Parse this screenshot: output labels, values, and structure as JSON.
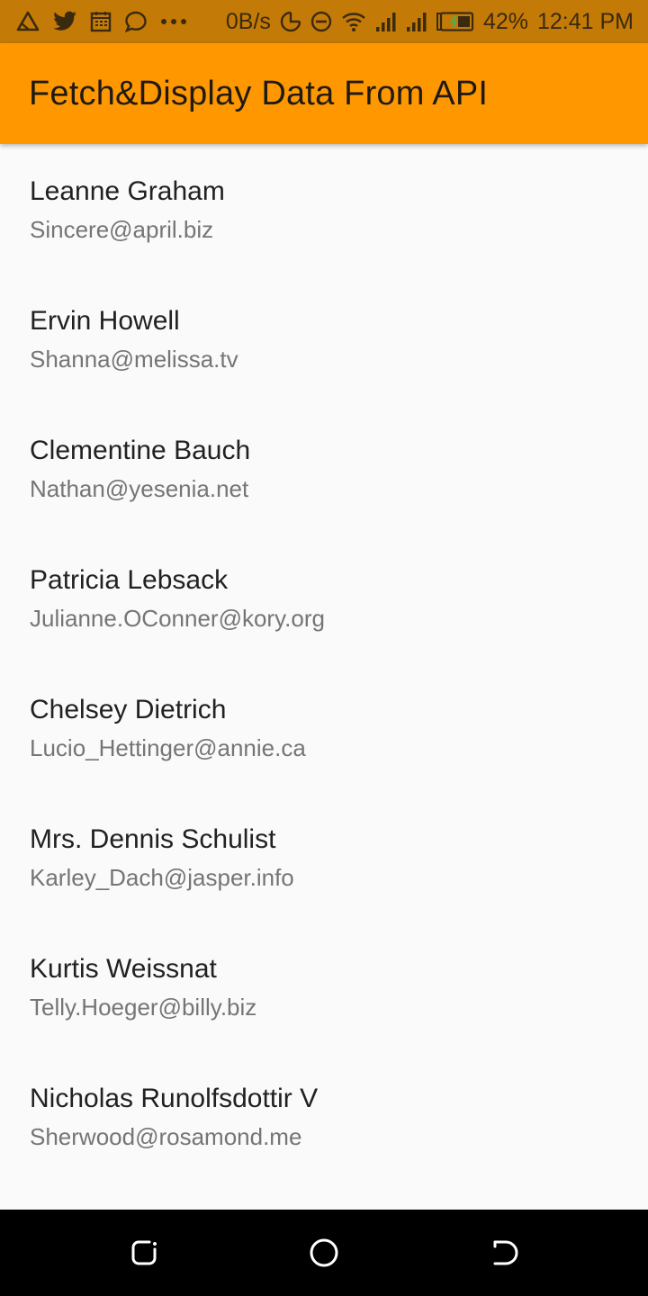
{
  "status_bar": {
    "net_speed": "0B/s",
    "battery": "42%",
    "time": "12:41 PM",
    "icons": [
      "warning-icon",
      "twitter-icon",
      "calendar-icon",
      "chat-icon",
      "more-icon",
      "data-saver-icon",
      "dnd-icon",
      "wifi-icon",
      "signal-icon",
      "signal-2-icon",
      "battery-icon"
    ]
  },
  "app_bar": {
    "title": "Fetch&Display Data From API",
    "color": "#ff9800"
  },
  "users": [
    {
      "name": "Leanne Graham",
      "email": "Sincere@april.biz"
    },
    {
      "name": "Ervin Howell",
      "email": "Shanna@melissa.tv"
    },
    {
      "name": "Clementine Bauch",
      "email": "Nathan@yesenia.net"
    },
    {
      "name": "Patricia Lebsack",
      "email": "Julianne.OConner@kory.org"
    },
    {
      "name": "Chelsey Dietrich",
      "email": "Lucio_Hettinger@annie.ca"
    },
    {
      "name": "Mrs. Dennis Schulist",
      "email": "Karley_Dach@jasper.info"
    },
    {
      "name": "Kurtis Weissnat",
      "email": "Telly.Hoeger@billy.biz"
    },
    {
      "name": "Nicholas Runolfsdottir V",
      "email": "Sherwood@rosamond.me"
    }
  ],
  "nav_bar": {
    "icons": [
      "recents-icon",
      "home-icon",
      "back-icon"
    ]
  }
}
